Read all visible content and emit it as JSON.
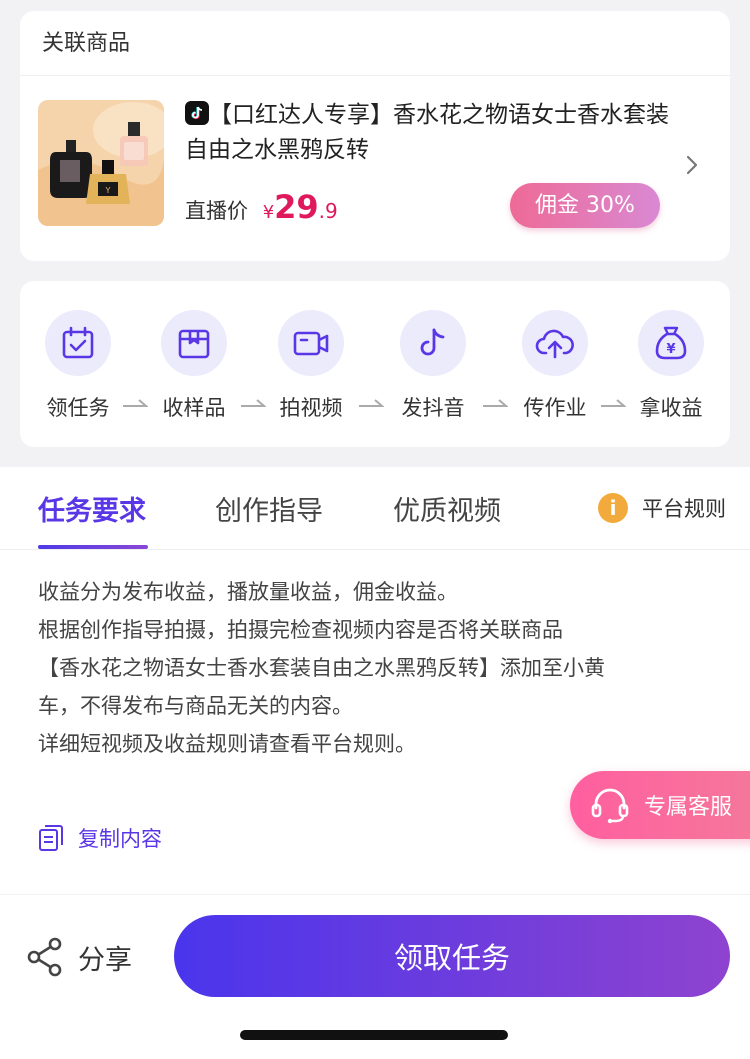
{
  "product_section": {
    "title": "关联商品",
    "name": "【口红达人专享】香水花之物语女士香水套装自由之水黑鸦反转",
    "price_label": "直播价",
    "currency": "¥",
    "price_integer": "29",
    "price_decimal": ".9",
    "commission": "佣金 30%"
  },
  "steps": [
    {
      "label": "领任务",
      "icon": "calendar-check-icon"
    },
    {
      "label": "收样品",
      "icon": "package-box-icon"
    },
    {
      "label": "拍视频",
      "icon": "video-camera-icon"
    },
    {
      "label": "发抖音",
      "icon": "tiktok-note-icon"
    },
    {
      "label": "传作业",
      "icon": "cloud-upload-icon"
    },
    {
      "label": "拿收益",
      "icon": "money-bag-icon"
    }
  ],
  "tabs": {
    "items": [
      "任务要求",
      "创作指导",
      "优质视频"
    ],
    "active_index": 0,
    "rules_label": "平台规则"
  },
  "description": {
    "lines": [
      "收益分为发布收益，播放量收益，佣金收益。",
      "根据创作指导拍摄，拍摄完检查视频内容是否将关联商品",
      "【香水花之物语女士香水套装自由之水黑鸦反转】添加至小黄",
      "车，不得发布与商品无关的内容。",
      "详细短视频及收益规则请查看平台规则。"
    ],
    "copy_label": "复制内容"
  },
  "customer_service": {
    "label": "专属客服"
  },
  "bottom_bar": {
    "share_label": "分享",
    "claim_label": "领取任务"
  },
  "colors": {
    "accent": "#5a37e6",
    "price": "#e0195d",
    "commission_gradient": [
      "#ee6a96",
      "#d989d3"
    ],
    "button_gradient": [
      "#4a35ec",
      "#8e43cf"
    ],
    "step_circle_bg": "#ecebfc",
    "service_bubble": "#ff5f9f",
    "info_icon": "#f3aa3c"
  }
}
